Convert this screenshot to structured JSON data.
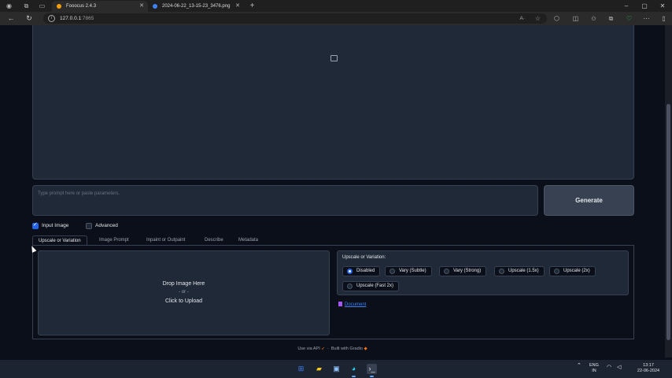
{
  "browser": {
    "tabs": [
      {
        "title": "Fooocus 2.4.3",
        "active": true
      },
      {
        "title": "2024-06-22_13-15-23_3476.png",
        "active": false
      }
    ],
    "new_tab": "+",
    "url_host": "127.0.0.1",
    "url_port": ":7865",
    "read_aloud": "A·"
  },
  "main": {
    "prompt_placeholder": "Type prompt here or paste parameters.",
    "generate_label": "Generate",
    "input_image_label": "Input Image",
    "input_image_checked": true,
    "advanced_label": "Advanced",
    "advanced_checked": false
  },
  "image_tabs": [
    {
      "label": "Upscale or Variation",
      "active": true
    },
    {
      "label": "Image Prompt",
      "active": false
    },
    {
      "label": "Inpaint or Outpaint",
      "active": false
    },
    {
      "label": "Describe",
      "active": false
    },
    {
      "label": "Metadata",
      "active": false
    }
  ],
  "upload": {
    "line1": "Drop Image Here",
    "line2": "- or -",
    "line3": "Click to Upload"
  },
  "upscale": {
    "title": "Upscale or Variation:",
    "options": [
      {
        "label": "Disabled",
        "selected": true
      },
      {
        "label": "Vary (Subtle)",
        "selected": false
      },
      {
        "label": "Vary (Strong)",
        "selected": false
      },
      {
        "label": "Upscale (1.5x)",
        "selected": false
      },
      {
        "label": "Upscale (2x)",
        "selected": false
      },
      {
        "label": "Upscale (Fast 2x)",
        "selected": false
      }
    ],
    "doc_link": "Document"
  },
  "footer": {
    "api": "Use via API",
    "separator": "·",
    "built": "Built with Gradio"
  },
  "taskbar": {
    "language": "ENG",
    "region": "IN",
    "time": "13:17",
    "date": "22-06-2024"
  },
  "colors": {
    "page_bg": "#0b0f19",
    "panel_bg": "#1f2937",
    "accent": "#2563eb",
    "link": "#3b82f6"
  }
}
